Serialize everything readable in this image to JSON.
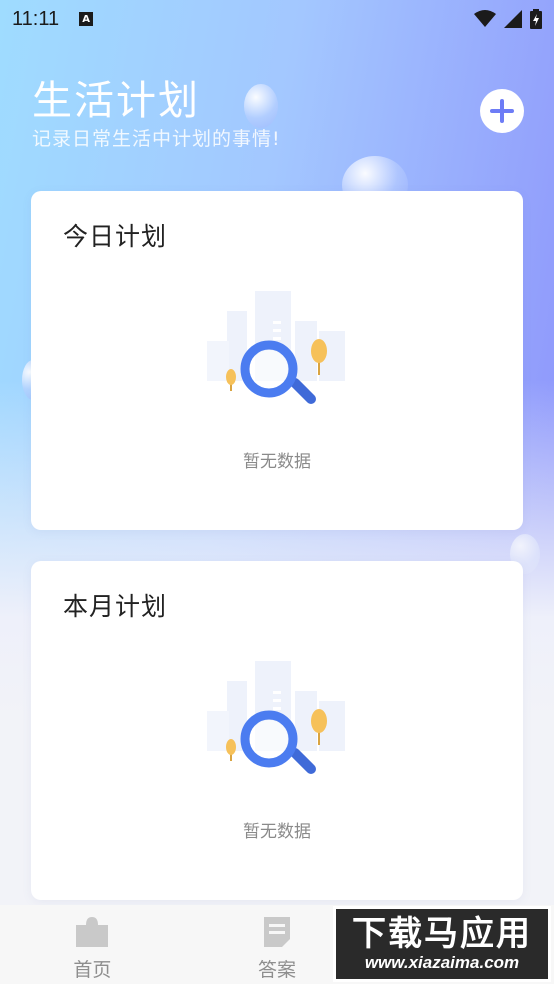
{
  "status_bar": {
    "time": "11:11",
    "notification_icon": "a-letter-icon",
    "notification_letter": "A",
    "icons": [
      "wifi-icon",
      "signal-icon",
      "battery-icon"
    ]
  },
  "header": {
    "title": "生活计划",
    "subtitle": "记录日常生活中计划的事情!",
    "add_icon": "plus-icon"
  },
  "cards": [
    {
      "title": "今日计划",
      "empty_text": "暂无数据"
    },
    {
      "title": "本月计划",
      "empty_text": "暂无数据"
    }
  ],
  "bottom_nav": {
    "items": [
      {
        "label": "首页",
        "icon": "puzzle-icon"
      },
      {
        "label": "答案",
        "icon": "document-icon"
      },
      {
        "label": "",
        "icon": ""
      }
    ]
  },
  "watermark": {
    "main": "下载马应用",
    "sub": "www.xiazaima.com"
  },
  "colors": {
    "accent": "#6d7cf6",
    "bg_gradient_start": "#9fdcff",
    "bg_gradient_end": "#8d93fb"
  }
}
